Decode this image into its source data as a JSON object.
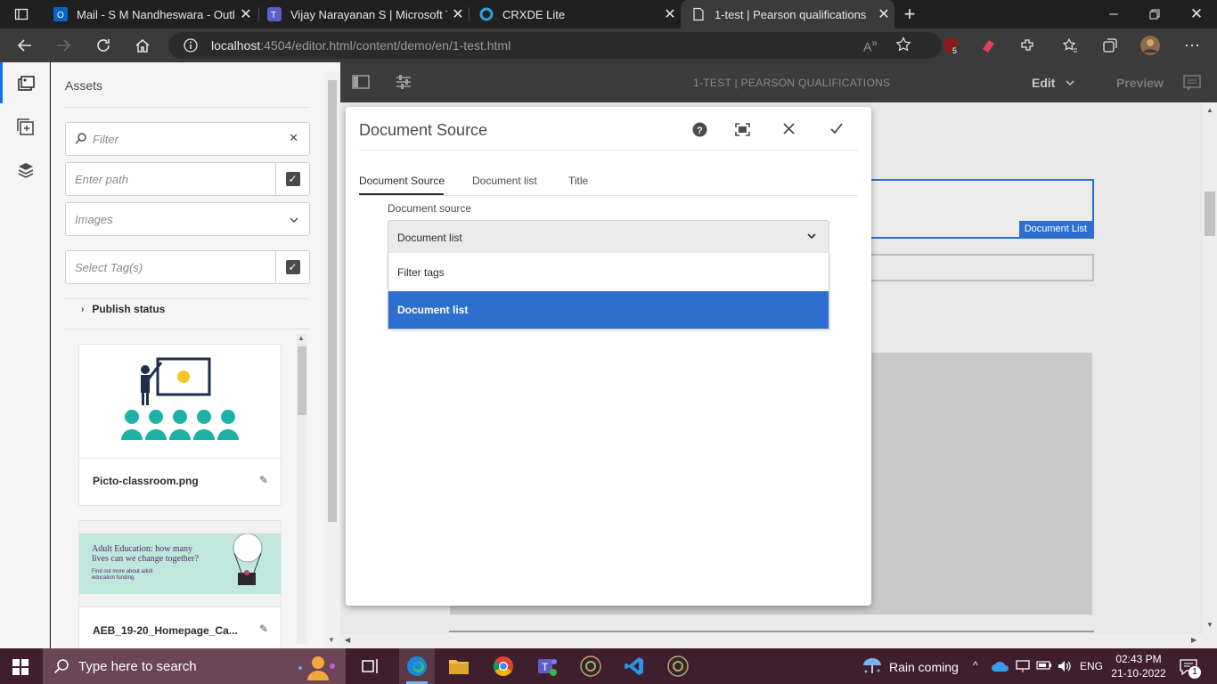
{
  "browser": {
    "tabs": [
      {
        "title": "Mail - S M Nandheswara - Outlo",
        "icon": "outlook-icon"
      },
      {
        "title": "Vijay Narayanan S | Microsoft Te",
        "icon": "teams-icon"
      },
      {
        "title": "CRXDE Lite",
        "icon": "crxde-icon"
      },
      {
        "title": "1-test | Pearson qualifications",
        "icon": "page-icon",
        "active": true
      }
    ],
    "url_host": "localhost",
    "url_rest": ":4504/editor.html/content/demo/en/1-test.html",
    "extension_badge": "5"
  },
  "sidepanel": {
    "title": "Assets",
    "filter_placeholder": "Filter",
    "path_placeholder": "Enter path",
    "type_value": "Images",
    "tags_placeholder": "Select Tag(s)",
    "publish_status": "Publish status",
    "assets": [
      {
        "name": "Picto-classroom.png"
      },
      {
        "name": "AEB_19-20_Homepage_Ca...",
        "banner_line1": "Adult Education: how many",
        "banner_line2": "lives can we change together?",
        "banner_link1": "Find out more about adult",
        "banner_link2": "education funding"
      }
    ]
  },
  "editor": {
    "page_title": "1-TEST | PEARSON QUALIFICATIONS",
    "mode": "Edit",
    "preview": "Preview",
    "component_label": "Document List"
  },
  "dialog": {
    "title": "Document Source",
    "tabs": [
      "Document Source",
      "Document list",
      "Title"
    ],
    "field_label": "Document source",
    "selected": "Document list",
    "options": [
      "Filter tags",
      "Document list"
    ]
  },
  "taskbar": {
    "search_placeholder": "Type here to search",
    "weather": "Rain coming",
    "language": "ENG",
    "time": "02:43 PM",
    "date": "21-10-2022",
    "notifications": "1"
  },
  "colors": {
    "accent": "#2d6fcf",
    "aem_blue": "#1473e6",
    "taskbar": "#3f1f2e"
  }
}
